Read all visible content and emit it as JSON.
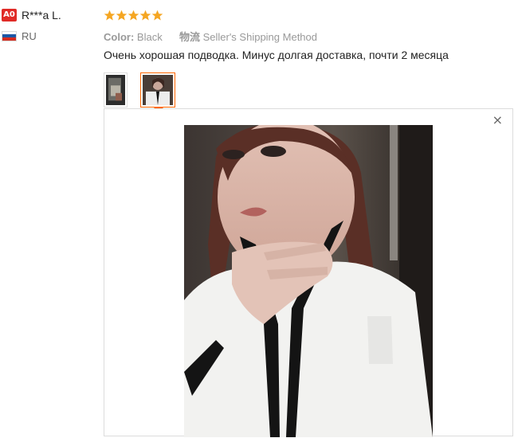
{
  "reviewer": {
    "level_badge": "A0",
    "name": "R***a L.",
    "country_code": "RU",
    "flag_colors": [
      "#ffffff",
      "#1c57a5",
      "#d52b1e"
    ]
  },
  "review": {
    "rating": 5,
    "star_color": "#f5a623",
    "meta": {
      "color_label": "Color:",
      "color_value": "Black",
      "shipping_label": "物流",
      "shipping_value": "Seller's Shipping Method"
    },
    "text": "Очень хорошая подводка. Минус долгая доставка, почти 2 месяца",
    "thumbnails": [
      {
        "icon": "photo-thumbnail",
        "active": false
      },
      {
        "icon": "photo-thumbnail",
        "active": true
      }
    ],
    "accent_color": "#ff6600"
  },
  "viewer": {
    "close_label": "×",
    "image_icon": "review-photo"
  }
}
